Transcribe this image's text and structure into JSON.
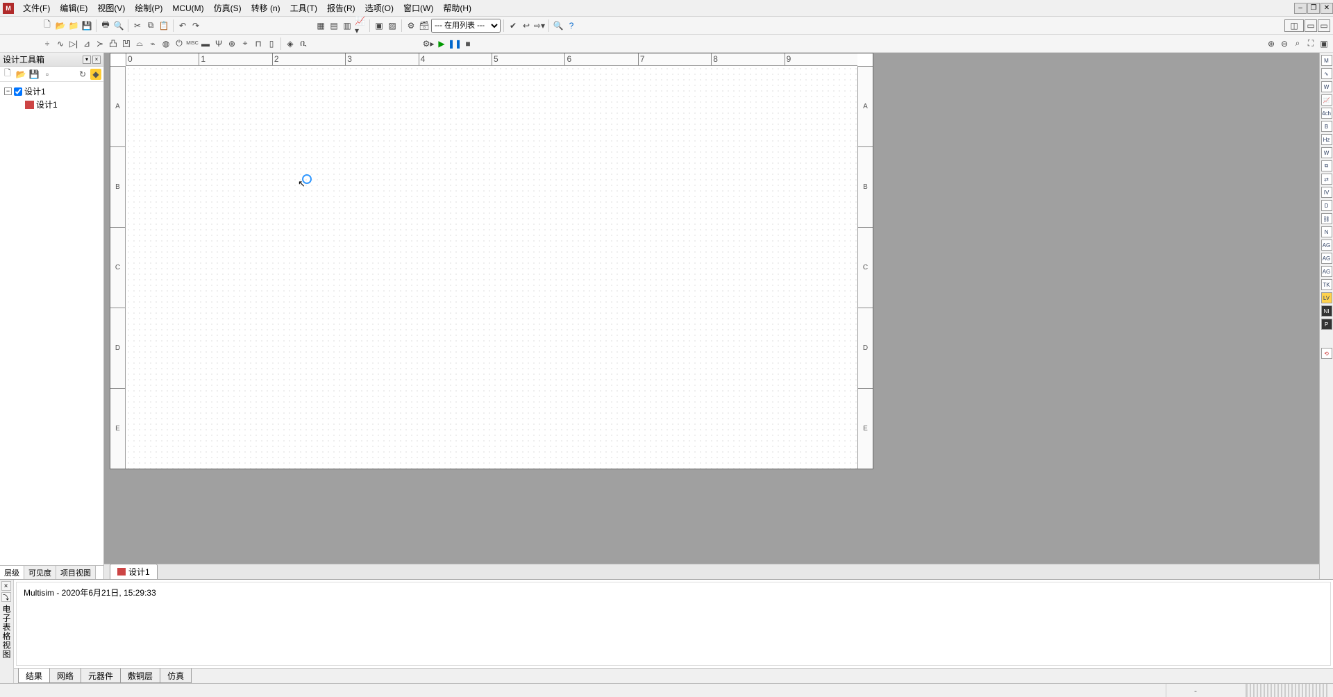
{
  "menus": {
    "file": "文件(F)",
    "edit": "编辑(E)",
    "view": "视图(V)",
    "place": "绘制(P)",
    "mcu": "MCU(M)",
    "simulate": "仿真(S)",
    "transfer": "转移 (n)",
    "tools": "工具(T)",
    "reports": "报告(R)",
    "options": "选项(O)",
    "window": "窗口(W)",
    "help": "帮助(H)"
  },
  "toolbar1": {
    "list_dropdown": "--- 在用列表 ---"
  },
  "toolbox": {
    "title": "设计工具箱",
    "root": "设计1",
    "child": "设计1",
    "tabs": {
      "hierarchy": "层级",
      "visibility": "可见度",
      "project": "项目视图"
    }
  },
  "ruler_h": [
    "0",
    "1",
    "2",
    "3",
    "4",
    "5",
    "6",
    "7",
    "8",
    "9"
  ],
  "ruler_v": [
    "A",
    "B",
    "C",
    "D",
    "E"
  ],
  "doc_tab": "设计1",
  "bottom": {
    "panel_label": "电子表格视图",
    "log_text": "Multisim  -  2020年6月21日, 15:29:33",
    "tabs": {
      "results": "结果",
      "nets": "网络",
      "components": "元器件",
      "copper": "敷铜层",
      "simulation": "仿真"
    }
  },
  "statusbar": {
    "field1": "-",
    "field2": ""
  }
}
